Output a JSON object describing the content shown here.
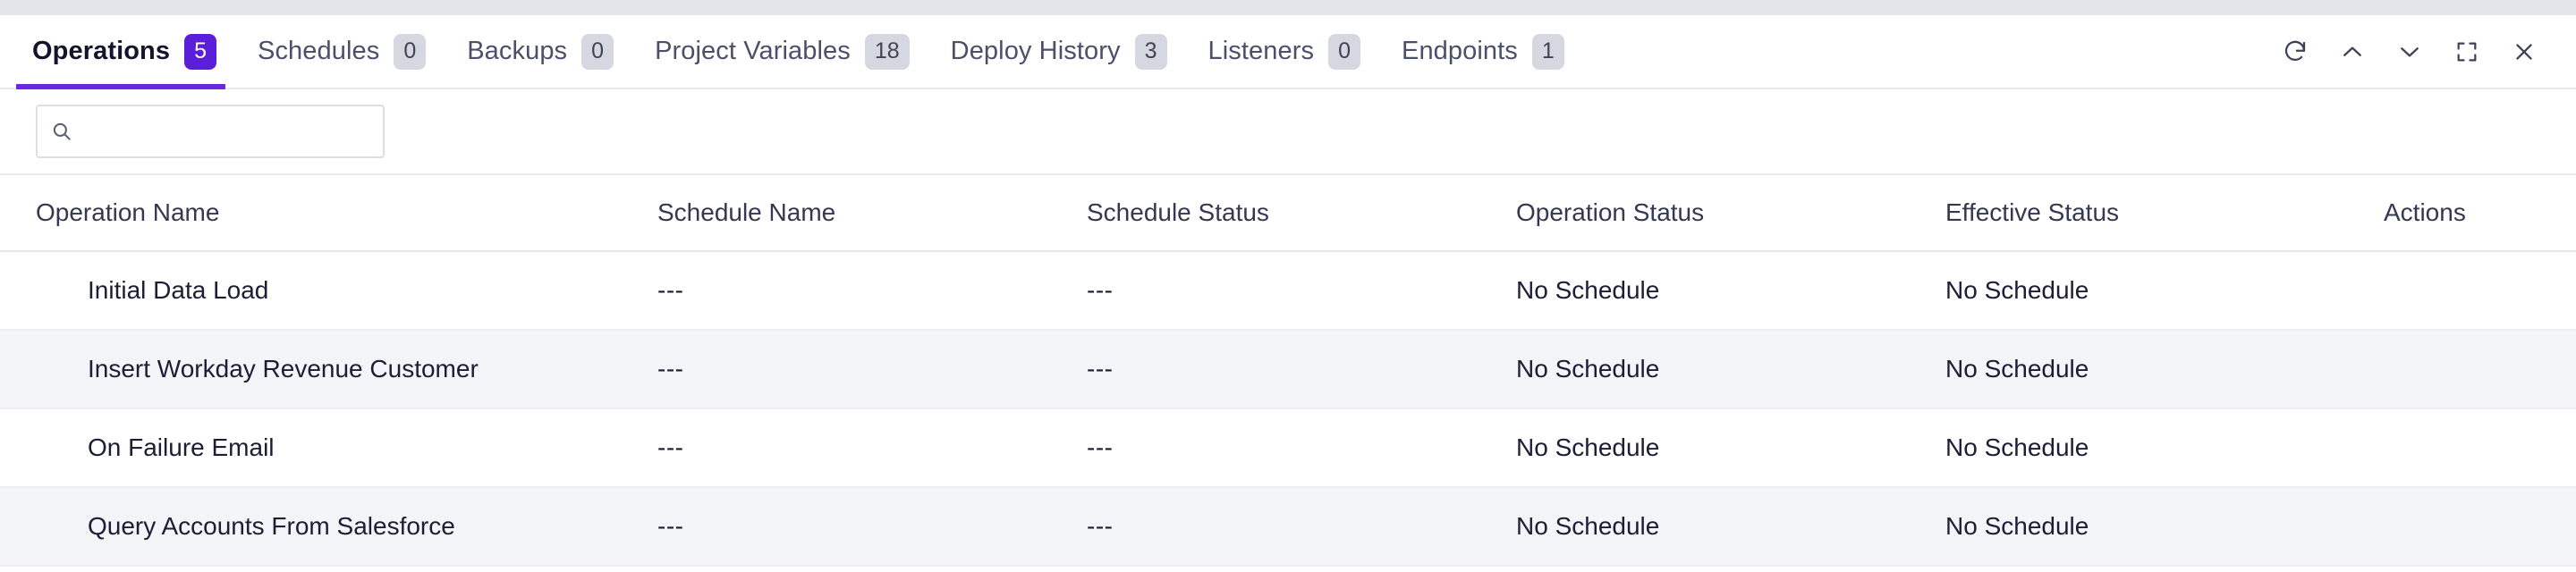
{
  "theme": {
    "accent": "#5c1fd9",
    "accent_underline": "#6d27e0",
    "badge_inactive_bg": "#d6d8e1",
    "row_alt_bg": "#f4f5f8",
    "text_primary": "#1b1e35",
    "top_strip": "#e3e4ea"
  },
  "tabs": [
    {
      "label": "Operations",
      "badge": "5",
      "active": true,
      "name": "tab-operations"
    },
    {
      "label": "Schedules",
      "badge": "0",
      "active": false,
      "name": "tab-schedules"
    },
    {
      "label": "Backups",
      "badge": "0",
      "active": false,
      "name": "tab-backups"
    },
    {
      "label": "Project Variables",
      "badge": "18",
      "active": false,
      "name": "tab-project-variables"
    },
    {
      "label": "Deploy History",
      "badge": "3",
      "active": false,
      "name": "tab-deploy-history"
    },
    {
      "label": "Listeners",
      "badge": "0",
      "active": false,
      "name": "tab-listeners"
    },
    {
      "label": "Endpoints",
      "badge": "1",
      "active": false,
      "name": "tab-endpoints"
    }
  ],
  "window_controls": [
    {
      "icon": "refresh-icon",
      "name": "refresh-button"
    },
    {
      "icon": "chevron-up-icon",
      "name": "collapse-button"
    },
    {
      "icon": "chevron-down-icon",
      "name": "expand-button"
    },
    {
      "icon": "fullscreen-icon",
      "name": "maximize-button"
    },
    {
      "icon": "close-icon",
      "name": "close-button"
    }
  ],
  "search": {
    "value": "",
    "placeholder": "",
    "icon": "search-icon"
  },
  "table": {
    "columns": [
      "Operation Name",
      "Schedule Name",
      "Schedule Status",
      "Operation Status",
      "Effective Status",
      "Actions"
    ],
    "rows": [
      {
        "operation_name": "Initial Data Load",
        "schedule_name": "---",
        "schedule_status": "---",
        "operation_status": "No Schedule",
        "effective_status": "No Schedule",
        "actions": ""
      },
      {
        "operation_name": "Insert Workday Revenue Customer",
        "schedule_name": "---",
        "schedule_status": "---",
        "operation_status": "No Schedule",
        "effective_status": "No Schedule",
        "actions": ""
      },
      {
        "operation_name": "On Failure Email",
        "schedule_name": "---",
        "schedule_status": "---",
        "operation_status": "No Schedule",
        "effective_status": "No Schedule",
        "actions": ""
      },
      {
        "operation_name": "Query Accounts From Salesforce",
        "schedule_name": "---",
        "schedule_status": "---",
        "operation_status": "No Schedule",
        "effective_status": "No Schedule",
        "actions": ""
      }
    ]
  }
}
